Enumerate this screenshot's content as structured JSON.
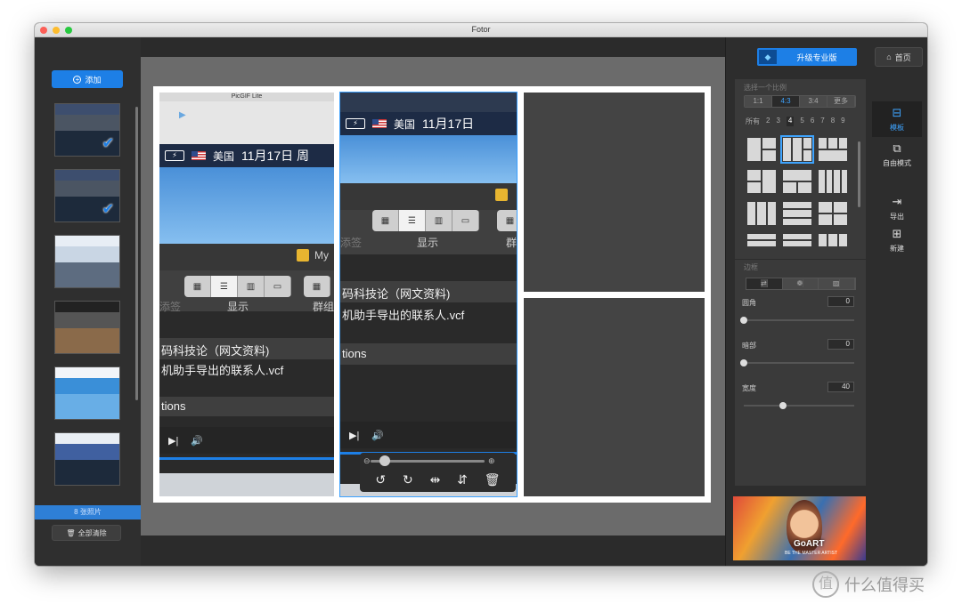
{
  "window": {
    "title": "Fotor"
  },
  "left": {
    "add_label": "添加",
    "photo_count": "8 张照片",
    "clear_label": "全部清除"
  },
  "collage": {
    "cell_a": {
      "titlebar": "PicGIF Lite",
      "status_country": "美国",
      "status_date": "11月17日 周",
      "folder": "My",
      "tag_label": "添签",
      "display_label": "显示",
      "group_label": "群组",
      "file_title": "码科技论（网文资料)",
      "file_name": "机助手导出的联系人.vcf",
      "partial": "tions"
    },
    "cell_b": {
      "status_country": "美国",
      "status_date": "11月17日",
      "tag_label": "添签",
      "display_label": "显示",
      "group_label": "群",
      "file_title": "码科技论（网文资料)",
      "file_name": "机助手导出的联系人.vcf",
      "partial": "tions"
    }
  },
  "right": {
    "upgrade_label": "升级专业版",
    "home_label": "首页",
    "ratio_title": "选择一个比例",
    "ratios": [
      "1:1",
      "4:3",
      "3:4",
      "更多"
    ],
    "counts": [
      "所有",
      "2",
      "3",
      "4",
      "5",
      "6",
      "7",
      "8",
      "9"
    ],
    "border_title": "边框",
    "corner_label": "圆角",
    "corner_value": "0",
    "shadow_label": "暗部",
    "shadow_value": "0",
    "width_label": "宽度",
    "width_value": "40",
    "promo_title": "GoART",
    "promo_sub": "BE THE MASTER ARTIST",
    "tools": {
      "template": "模板",
      "freestyle": "自由模式",
      "export": "导出",
      "new": "新建"
    }
  },
  "watermark": {
    "text": "什么值得买",
    "glyph": "值"
  }
}
